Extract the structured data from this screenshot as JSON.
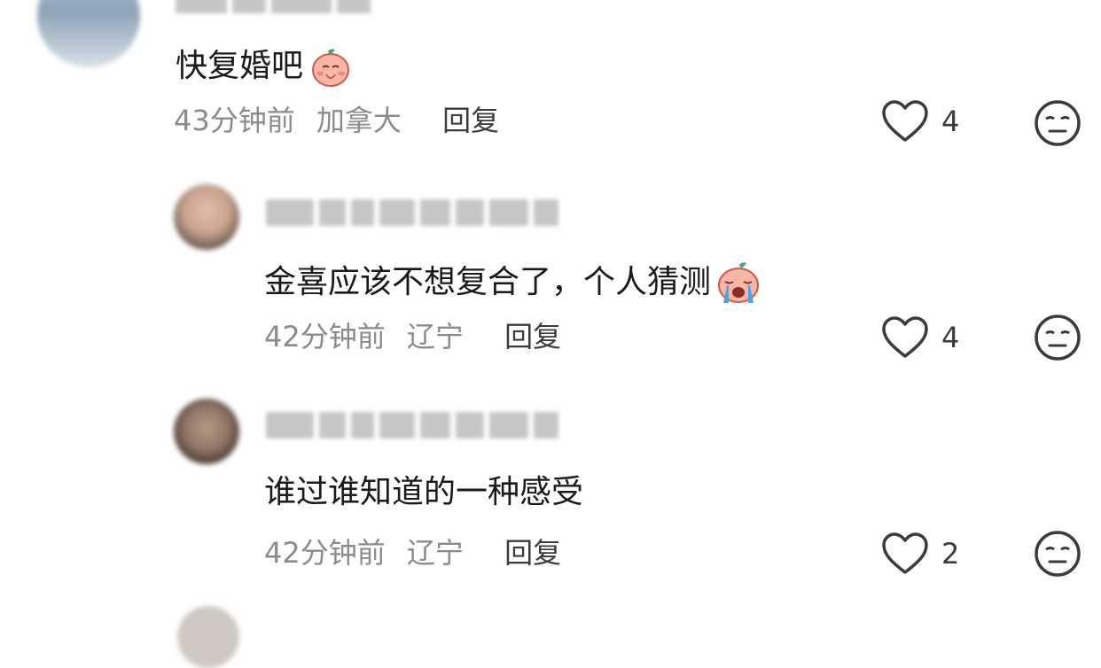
{
  "comments": [
    {
      "text": "快复婚吧",
      "time": "43分钟前",
      "location": "加拿大",
      "reply_label": "回复",
      "likes": "4",
      "emoji": "praying-face-emoji"
    },
    {
      "text": "金喜应该不想复合了，个人猜测",
      "time": "42分钟前",
      "location": "辽宁",
      "reply_label": "回复",
      "likes": "4",
      "emoji": "crying-face-emoji"
    },
    {
      "text": "谁过谁知道的一种感受",
      "time": "42分钟前",
      "location": "辽宁",
      "reply_label": "回复",
      "likes": "2"
    }
  ],
  "icons": {
    "like": "heart-outline-icon",
    "dislike": "neutral-face-icon"
  },
  "colors": {
    "text": "#1a1a1a",
    "meta": "#8a8a8f",
    "icon": "#3a3a3f"
  }
}
